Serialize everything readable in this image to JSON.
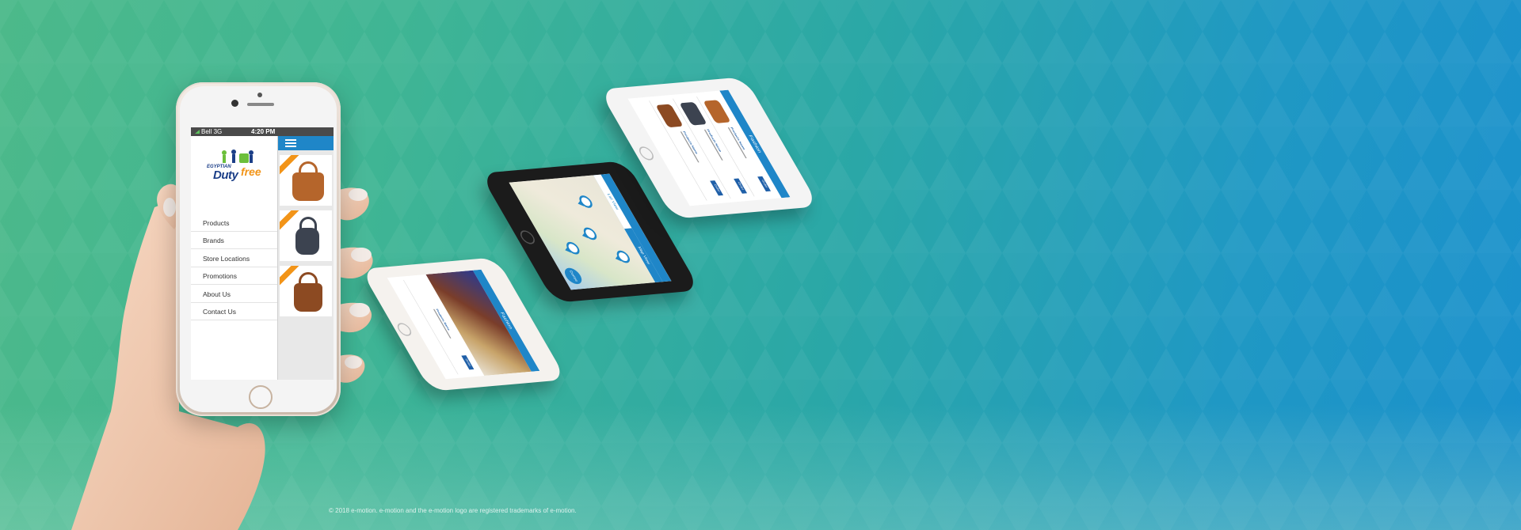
{
  "main_phone": {
    "status_bar": {
      "carrier": "Bell 3G",
      "time": "4:20 PM"
    },
    "logo": {
      "small_text": "EGYPTIAN",
      "primary": "Duty",
      "accent": "free"
    },
    "menu_items": [
      {
        "label": "Products"
      },
      {
        "label": "Brands"
      },
      {
        "label": "Store Locations"
      },
      {
        "label": "Promotions"
      },
      {
        "label": "About Us"
      },
      {
        "label": "Contact Us"
      }
    ],
    "products": [
      {
        "color": "#b5652b"
      },
      {
        "color": "#3c4350"
      },
      {
        "color": "#8c4a22"
      }
    ]
  },
  "iso_phone_top": {
    "title": "Fashion",
    "order_label": "Order",
    "product_title": "Products Name"
  },
  "iso_phone_map": {
    "tabs": [
      "List View",
      "Map View"
    ],
    "fab_label": "Centre"
  },
  "iso_phone_front": {
    "title": "Fashion",
    "order_label": "Order",
    "product_title": "Products Name"
  },
  "footer": {
    "copyright": "© 2018 e-motion. e-motion and the e-motion logo are registered trademarks of e-motion."
  },
  "colors": {
    "accent_blue": "#1f86c8",
    "ribbon_orange": "#f29418",
    "brand_navy": "#1c3f88"
  }
}
